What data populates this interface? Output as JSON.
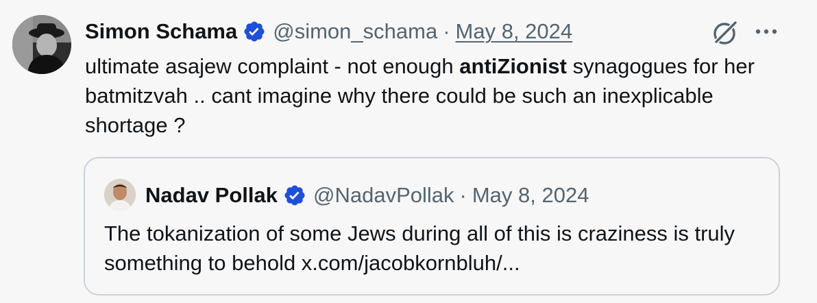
{
  "tweet": {
    "author_name": "Simon Schama",
    "handle": "@simon_schama",
    "separator": "·",
    "date": "May 8, 2024",
    "verified_icon": "verified-badge-icon",
    "grok_icon": "grok-icon",
    "more_icon": "more-options-icon",
    "text_before": "ultimate asajew complaint - not enough ",
    "text_bold": "antiZionist",
    "text_after": " synagogues for her batmitzvah .. cant imagine why there could be such an inexplicable shortage ?"
  },
  "quote": {
    "author_name": "Nadav Pollak",
    "handle": "@NadavPollak",
    "separator": "·",
    "date": "May 8, 2024",
    "verified_icon": "verified-badge-icon",
    "text": "The tokanization of some Jews during all of this is craziness is truly something to behold x.com/jacobkornbluh/..."
  },
  "colors": {
    "background": "#f7f7f7",
    "text": "#0f1419",
    "secondary": "#536471",
    "verified": "#1d4fd8",
    "border": "#c8d1da"
  }
}
